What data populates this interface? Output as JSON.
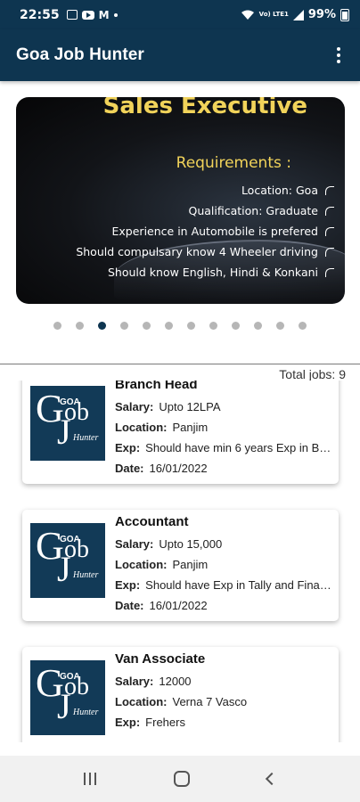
{
  "status_bar": {
    "time": "22:55",
    "carrier_icons": [
      "image-icon",
      "youtube-icon",
      "gmail-icon",
      "dot"
    ],
    "gmail_letter": "M",
    "signal": "VoLTE",
    "lte_label": "Vo) LTE1",
    "battery": "99%"
  },
  "app_bar": {
    "title": "Goa Job Hunter",
    "menu_icon": "more-vert-icon"
  },
  "banner": {
    "title": "Sales Executive",
    "requirements_label": "Requirements :",
    "lines": [
      "Location: Goa",
      "Qualification: Graduate",
      "Experience in Automobile is prefered",
      "Should compulsary know 4 Wheeler driving",
      "Should know English, Hindi & Konkani"
    ]
  },
  "carousel": {
    "count": 12,
    "active_index": 2
  },
  "total_jobs": "Total jobs: 9",
  "logo": {
    "goa": "GOA",
    "g": "G",
    "ob": "ob",
    "j": "J",
    "hunter": "Hunter"
  },
  "labels": {
    "salary": "Salary:",
    "location": "Location:",
    "exp": "Exp:",
    "date": "Date:"
  },
  "jobs": [
    {
      "title": "Branch Head",
      "salary": "Upto 12LPA",
      "location": "Panjim",
      "exp": "Should have min 6 years Exp in Ba...",
      "date": "16/01/2022"
    },
    {
      "title": "Accountant",
      "salary": "Upto 15,000",
      "location": "Panjim",
      "exp": "Should have Exp in Tally and Finali...",
      "date": "16/01/2022"
    },
    {
      "title": "Van Associate",
      "salary": "12000",
      "location": "Verna 7 Vasco",
      "exp": "Frehers",
      "date": ""
    }
  ],
  "nav_bar": {
    "recent_icon": "recent-apps-icon",
    "home_icon": "home-icon",
    "back_icon": "back-icon"
  },
  "colors": {
    "primary": "#0e3550",
    "banner_yellow": "#f1d35a",
    "dot_inactive": "#b6b6b6"
  }
}
